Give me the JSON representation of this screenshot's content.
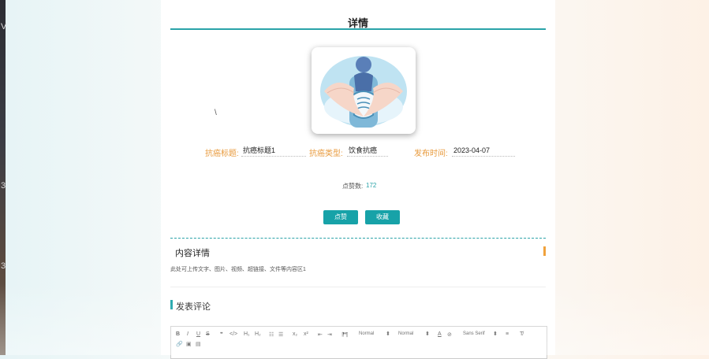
{
  "left_edge": {
    "glyphs": [
      "V",
      "3",
      "3"
    ]
  },
  "detail": {
    "title": "详情",
    "stray_mark": "\\",
    "fields": {
      "title_label": "抗癌标题:",
      "title_value": "抗癌标题1",
      "type_label": "抗癌类型:",
      "type_value": "饮食抗癌",
      "date_label": "发布时间:",
      "date_value": "2023-04-07"
    },
    "clicks_label": "点赞数:",
    "clicks_value": "172",
    "buttons": {
      "like": "点赞",
      "favorite": "收藏"
    }
  },
  "content_section": {
    "heading": "内容详情",
    "body": "此处可上传文字、图片、视频、超链接、文件等内容区1"
  },
  "comment_section": {
    "heading": "发表评论",
    "toolbar": {
      "bold": "B",
      "italic": "I",
      "underline": "U",
      "strike": "S",
      "quote": "❞",
      "code": "</>",
      "h1": "H₁",
      "h2": "H₂",
      "ol": "☷",
      "ul": "☰",
      "sub": "x₂",
      "sup": "x²",
      "outdent": "⇤",
      "indent": "⇥",
      "rtl": "⁋¶",
      "size_select": "Normal",
      "header_select": "Normal",
      "color": "A",
      "background": "⊘",
      "font_select": "Sans Serif",
      "align": "≡",
      "clean": "T̸",
      "link": "🔗",
      "image": "▣",
      "video": "▤"
    }
  },
  "colors": {
    "accent": "#17a2a8",
    "label": "#e89a3c"
  }
}
